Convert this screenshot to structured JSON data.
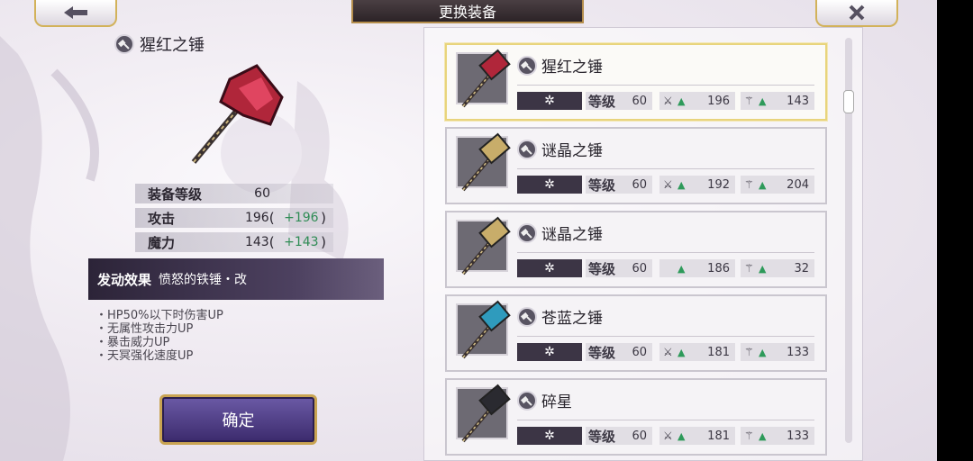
{
  "header": {
    "title": "更换装备",
    "back_icon": "arrow-left-icon",
    "close_icon": "close-icon"
  },
  "selected_weapon": {
    "name": "猩红之锤",
    "stats": [
      {
        "label": "装备等级",
        "value": "60",
        "bonus": ""
      },
      {
        "label": "攻击",
        "value": "196",
        "bonus": "+196"
      },
      {
        "label": "魔力",
        "value": "143",
        "bonus": "+143"
      }
    ],
    "effect": {
      "label": "发动效果",
      "name": "愤怒的铁锤・改"
    },
    "effect_list": [
      "・HP50%以下时伤害UP",
      "・无属性攻击力UP",
      "・暴击威力UP",
      "・天冥强化速度UP"
    ]
  },
  "confirm_label": "确定",
  "level_label": "等级",
  "rarity_symbol": "✲",
  "items": [
    {
      "name": "猩红之锤",
      "level": "60",
      "attack": "196",
      "magic": "143",
      "selected": true,
      "color": "#b0263a",
      "show_atk_icon": true
    },
    {
      "name": "谜晶之锤",
      "level": "60",
      "attack": "192",
      "magic": "204",
      "selected": false,
      "color": "#c8ad6a",
      "show_atk_icon": true
    },
    {
      "name": "谜晶之锤",
      "level": "60",
      "attack": "186",
      "magic": "32",
      "selected": false,
      "color": "#c8ad6a",
      "show_atk_icon": false
    },
    {
      "name": "苍蓝之锤",
      "level": "60",
      "attack": "181",
      "magic": "133",
      "selected": false,
      "color": "#2f9bbd",
      "show_atk_icon": true
    },
    {
      "name": "碎星",
      "level": "60",
      "attack": "181",
      "magic": "133",
      "selected": false,
      "color": "#2a2a30",
      "show_atk_icon": true
    }
  ]
}
